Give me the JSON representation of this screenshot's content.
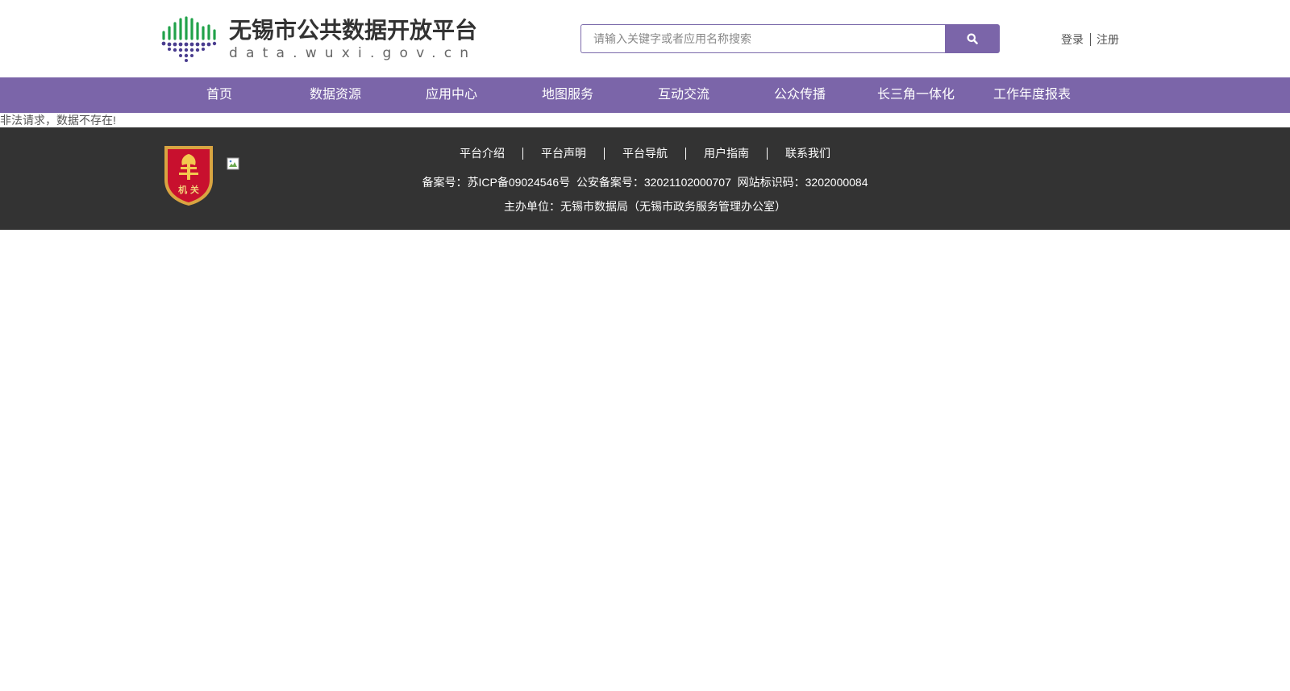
{
  "header": {
    "logo_title": "无锡市公共数据开放平台",
    "logo_domain": "data.wuxi.gov.cn",
    "search_placeholder": "请输入关键字或者应用名称搜索",
    "search_icon": "search-icon",
    "login_label": "登录",
    "register_label": "注册"
  },
  "nav": {
    "items": [
      {
        "label": "首页"
      },
      {
        "label": "数据资源"
      },
      {
        "label": "应用中心"
      },
      {
        "label": "地图服务"
      },
      {
        "label": "互动交流"
      },
      {
        "label": "公众传播"
      },
      {
        "label": "长三角一体化"
      },
      {
        "label": "工作年度报表"
      }
    ]
  },
  "main": {
    "error_message": "非法请求，数据不存在!"
  },
  "footer": {
    "badge_text": "机 关",
    "links": [
      {
        "label": "平台介绍"
      },
      {
        "label": "平台声明"
      },
      {
        "label": "平台导航"
      },
      {
        "label": "用户指南"
      },
      {
        "label": "联系我们"
      }
    ],
    "record_line": "备案号：苏ICP备09024546号  公安备案号：32021102000707  网站标识码：3202000084",
    "sponsor_line": "主办单位：无锡市数据局（无锡市政务服务管理办公室）"
  },
  "colors": {
    "brand_purple": "#7b65a9",
    "footer_bg": "#333333",
    "logo_green": "#21a24a",
    "logo_purple": "#4a3d8f",
    "badge_red": "#c8102e"
  }
}
